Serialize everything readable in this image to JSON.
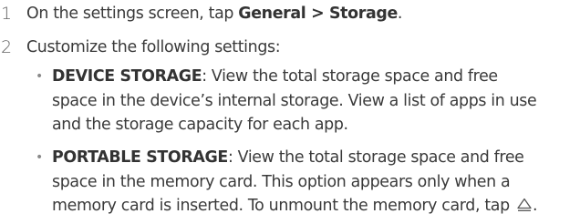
{
  "steps": [
    {
      "number": "1",
      "text_before": "On the settings screen, tap ",
      "bold": "General > Storage",
      "text_after": "."
    },
    {
      "number": "2",
      "text": "Customize the following settings:"
    }
  ],
  "bullets": [
    {
      "term": "DEVICE STORAGE",
      "line1": ": View the total storage space and free",
      "line2": "space in the device’s internal storage. View a list of apps in use",
      "line3": "and the storage capacity for each app."
    },
    {
      "term": "PORTABLE STORAGE",
      "line1": ": View the total storage space and free",
      "line2": "space in the memory card. This option appears only when a",
      "line3": "memory card is inserted. To unmount the memory card, tap",
      "line3_end": "."
    }
  ],
  "icons": {
    "unmount": "eject-triangle-icon"
  },
  "colors": {
    "text": "#3a3a3a",
    "bold": "#333333",
    "step_number": "#666666"
  }
}
